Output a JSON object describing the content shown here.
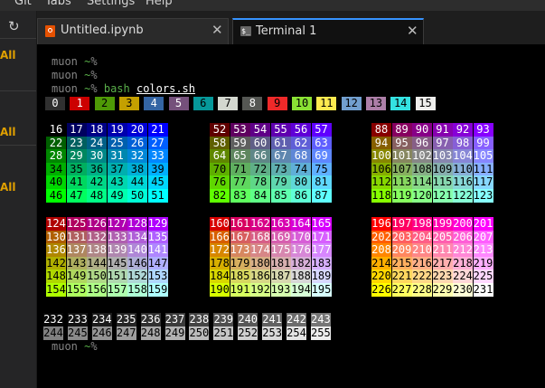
{
  "menu": {
    "items": [
      "Git",
      "Tabs",
      "Settings",
      "Help"
    ]
  },
  "sidebar": {
    "labels": [
      "All",
      "All",
      "All"
    ]
  },
  "tabs": [
    {
      "label": "Untitled.ipynb",
      "icon": "notebook-icon",
      "active": false
    },
    {
      "label": "Terminal 1",
      "icon": "terminal-icon",
      "active": true
    }
  ],
  "terminal": {
    "user": "muon",
    "tilde": "~",
    "pct": "%",
    "command": "bash",
    "arg": "colors.sh",
    "system_colors": {
      "0": "#303030",
      "1": "#cc0000",
      "2": "#4e9a06",
      "3": "#c4a000",
      "4": "#3465a4",
      "5": "#75507b",
      "6": "#06989a",
      "7": "#d3d7cf",
      "8": "#555753",
      "9": "#ef2929",
      "10": "#8ae234",
      "11": "#fce94f",
      "12": "#729fcf",
      "13": "#ad7fa8",
      "14": "#34e2e2",
      "15": "#eeeeec"
    },
    "system_rows": [
      [
        0,
        1,
        2,
        3,
        4,
        5,
        6,
        7,
        8,
        9,
        10,
        11,
        12,
        13,
        14,
        15
      ]
    ],
    "cube_blocks": [
      {
        "rows": [
          [
            16,
            17,
            18,
            19,
            20,
            21
          ],
          [
            22,
            23,
            24,
            25,
            26,
            27
          ],
          [
            28,
            29,
            30,
            31,
            32,
            33
          ],
          [
            34,
            35,
            36,
            37,
            38,
            39
          ],
          [
            40,
            41,
            42,
            43,
            44,
            45
          ],
          [
            46,
            47,
            48,
            49,
            50,
            51
          ]
        ]
      },
      {
        "rows": [
          [
            52,
            53,
            54,
            55,
            56,
            57
          ],
          [
            58,
            59,
            60,
            61,
            62,
            63
          ],
          [
            64,
            65,
            66,
            67,
            68,
            69
          ],
          [
            70,
            71,
            72,
            73,
            74,
            75
          ],
          [
            76,
            77,
            78,
            79,
            80,
            81
          ],
          [
            82,
            83,
            84,
            85,
            86,
            87
          ]
        ]
      },
      {
        "rows": [
          [
            88,
            89,
            90,
            91,
            92,
            93
          ],
          [
            94,
            95,
            96,
            97,
            98,
            99
          ],
          [
            100,
            101,
            102,
            103,
            104,
            105
          ],
          [
            106,
            107,
            108,
            109,
            110,
            111
          ],
          [
            112,
            113,
            114,
            115,
            116,
            117
          ],
          [
            118,
            119,
            120,
            121,
            122,
            123
          ]
        ]
      },
      {
        "rows": [
          [
            124,
            125,
            126,
            127,
            128,
            129
          ],
          [
            130,
            131,
            132,
            133,
            134,
            135
          ],
          [
            136,
            137,
            138,
            139,
            140,
            141
          ],
          [
            142,
            143,
            144,
            145,
            146,
            147
          ],
          [
            148,
            149,
            150,
            151,
            152,
            153
          ],
          [
            154,
            155,
            156,
            157,
            158,
            159
          ]
        ]
      },
      {
        "rows": [
          [
            160,
            161,
            162,
            163,
            164,
            165
          ],
          [
            166,
            167,
            168,
            169,
            170,
            171
          ],
          [
            172,
            173,
            174,
            175,
            176,
            177
          ],
          [
            178,
            179,
            180,
            181,
            182,
            183
          ],
          [
            184,
            185,
            186,
            187,
            188,
            189
          ],
          [
            190,
            191,
            192,
            193,
            194,
            195
          ]
        ]
      },
      {
        "rows": [
          [
            196,
            197,
            198,
            199,
            200,
            201
          ],
          [
            202,
            203,
            204,
            205,
            206,
            207
          ],
          [
            208,
            209,
            210,
            211,
            212,
            213
          ],
          [
            214,
            215,
            216,
            217,
            218,
            219
          ],
          [
            220,
            221,
            222,
            223,
            224,
            225
          ],
          [
            226,
            227,
            228,
            229,
            230,
            231
          ]
        ]
      }
    ],
    "gray_rows": [
      [
        232,
        233,
        234,
        235,
        236,
        237,
        238,
        239,
        240,
        241,
        242,
        243
      ],
      [
        244,
        245,
        246,
        247,
        248,
        249,
        250,
        251,
        252,
        253,
        254,
        255
      ]
    ]
  }
}
